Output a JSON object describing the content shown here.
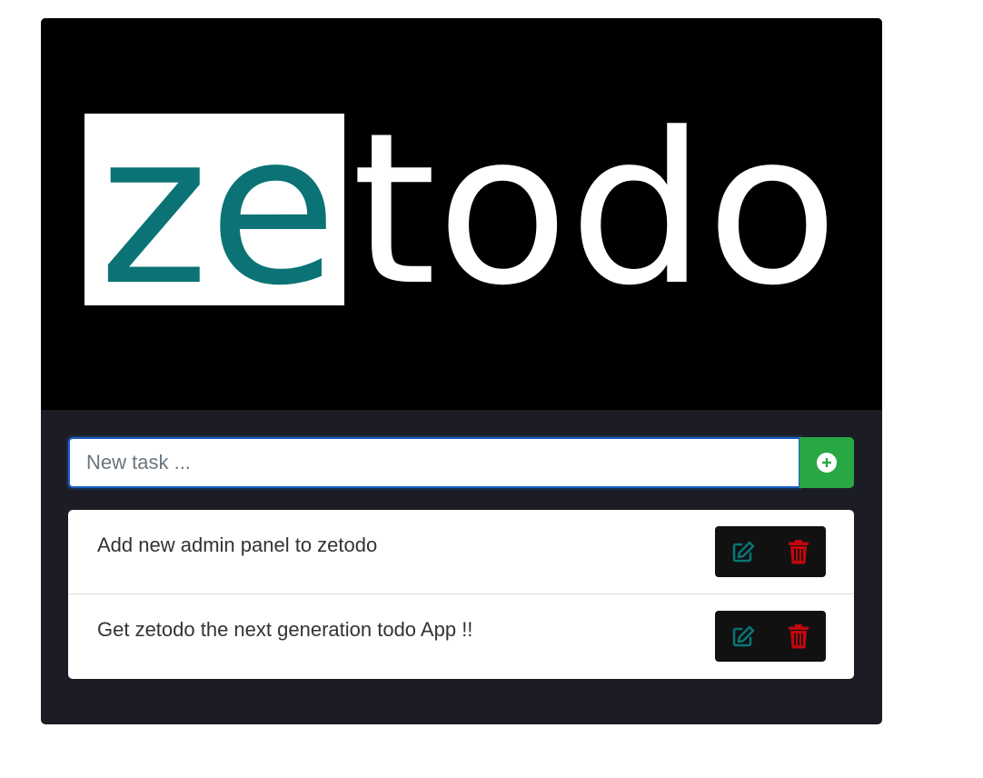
{
  "header": {
    "logo": {
      "text_prefix": "ze",
      "text_suffix": "todo",
      "name": "zetodo"
    }
  },
  "new_task": {
    "placeholder": "New task ...",
    "value": "",
    "add_icon": "plus-circle-icon"
  },
  "tasks": [
    {
      "text": "Add new admin panel to zetodo",
      "edit_icon": "edit-icon",
      "delete_icon": "trash-icon"
    },
    {
      "text": "Get zetodo the next generation todo App !!",
      "edit_icon": "edit-icon",
      "delete_icon": "trash-icon"
    }
  ],
  "colors": {
    "brand_teal": "#0b7375",
    "background_dark": "#1c1d24",
    "logo_background": "#000000",
    "add_button": "#28a745",
    "delete_red": "#c0070b",
    "action_bg": "#111111",
    "input_focus": "#1b5fc4"
  }
}
